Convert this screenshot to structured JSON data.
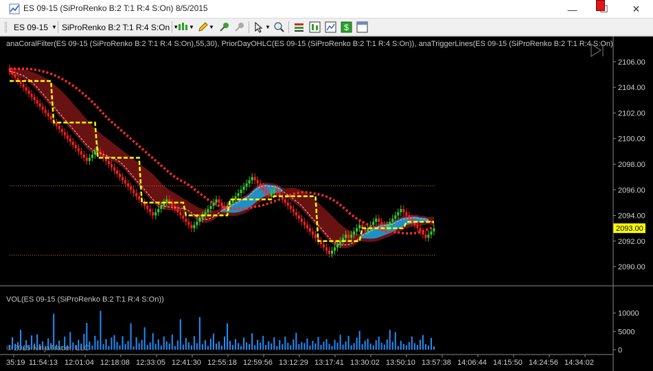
{
  "window": {
    "title": "ES 09-15 (SiProRenko B:2 T:1 R:4 S:On)  8/5/2015",
    "minimize_glyph": "—",
    "maximize_glyph": "☐",
    "close_glyph": "✕"
  },
  "toolbar": {
    "instrument": "ES 09-15",
    "period": "SiProRenko B:2 T:1 R:4 S:On",
    "icons": [
      "bar-type-icon",
      "drawing-pen-icon",
      "pin-icon",
      "pin-gray-icon",
      "pointer-icon",
      "zoom-icon",
      "indicators-icon",
      "strategies-icon",
      "chart-properties-icon",
      "dollar-icon",
      "data-box-icon"
    ]
  },
  "chart": {
    "indicator_label": "anaCoralFilter(ES 09-15 (SiProRenko B:2 T:1 R:4 S:On),55,30), PriorDayOHLC(ES 09-15 (SiProRenko B:2 T:1 R:4 S:On)), anaTriggerLines(ES 09-15 (SiProRenko B:2 T:1 R:4 S:On)",
    "volume_label": "VOL(ES 09-15 (SiProRenko B:2 T:1 R:4 S:On))",
    "copyright": "© 2015 NinjaTrader, LLC",
    "last_price": "2093.00",
    "colors": {
      "up_bar": "#32cd32",
      "down_bar": "#ff2020",
      "coral_band": "#7a1515",
      "coral_band_bull": "#1e90c8",
      "trigger_dot": "#ff2a2a",
      "trigger_dash": "#ffff00",
      "trigger_cyan": "#1ec8e6",
      "prior_day_line": "#c87832",
      "volume": "#1e90ff",
      "last_price_bg": "#ffff00"
    }
  },
  "chart_data": {
    "type": "line",
    "price_panel": {
      "ylim": [
        2089.2,
        2106.8
      ],
      "yticks": [
        "2106.00",
        "2104.00",
        "2102.00",
        "2100.00",
        "2098.00",
        "2096.00",
        "2094.00",
        "2092.00",
        "2090.00"
      ],
      "prior_day_high": 2096.3,
      "prior_day_low": 2090.9,
      "renko_close": [
        2105.25,
        2105.0,
        2104.75,
        2104.5,
        2104.25,
        2104.0,
        2103.75,
        2103.5,
        2103.25,
        2103.0,
        2102.75,
        2102.5,
        2102.25,
        2102.0,
        2101.75,
        2101.5,
        2101.25,
        2101.0,
        2100.75,
        2100.5,
        2100.25,
        2100.0,
        2099.75,
        2099.5,
        2099.25,
        2099.0,
        2098.75,
        2098.5,
        2098.25,
        2098.5,
        2098.75,
        2099.0,
        2099.25,
        2098.75,
        2098.5,
        2098.25,
        2098.0,
        2097.75,
        2097.5,
        2097.25,
        2097.0,
        2096.75,
        2096.5,
        2096.25,
        2096.0,
        2095.75,
        2095.5,
        2095.25,
        2095.0,
        2094.75,
        2094.5,
        2094.25,
        2094.0,
        2094.25,
        2094.5,
        2094.75,
        2095.0,
        2095.25,
        2095.0,
        2094.75,
        2094.5,
        2094.25,
        2094.0,
        2093.75,
        2093.5,
        2093.25,
        2093.0,
        2093.25,
        2093.5,
        2093.75,
        2094.0,
        2094.25,
        2094.5,
        2094.75,
        2095.0,
        2095.25,
        2095.0,
        2094.75,
        2094.5,
        2094.75,
        2095.0,
        2095.25,
        2095.5,
        2095.75,
        2096.0,
        2096.25,
        2096.5,
        2096.75,
        2097.0,
        2096.75,
        2096.5,
        2096.25,
        2096.0,
        2095.75,
        2095.5,
        2095.75,
        2096.0,
        2095.75,
        2095.5,
        2095.25,
        2095.0,
        2094.75,
        2094.5,
        2094.25,
        2094.0,
        2093.75,
        2093.5,
        2093.25,
        2093.0,
        2092.75,
        2092.5,
        2092.25,
        2092.0,
        2091.75,
        2091.5,
        2091.25,
        2091.0,
        2091.25,
        2091.5,
        2091.75,
        2092.0,
        2092.25,
        2092.5,
        2092.25,
        2092.5,
        2092.75,
        2093.0,
        2093.25,
        2093.0,
        2092.75,
        2093.0,
        2093.25,
        2093.5,
        2093.75,
        2093.5,
        2093.25,
        2093.0,
        2093.25,
        2093.5,
        2093.75,
        2094.0,
        2094.25,
        2094.5,
        2094.25,
        2094.0,
        2093.75,
        2093.5,
        2093.25,
        2093.0,
        2092.75,
        2092.5,
        2092.25,
        2092.5,
        2092.75,
        2093.0
      ]
    },
    "volume_panel": {
      "ylim": [
        0,
        12000
      ],
      "yticks": [
        "10000",
        "5000",
        "0"
      ],
      "values": [
        1200,
        3400,
        1600,
        2100,
        5400,
        800,
        2600,
        1100,
        3900,
        1700,
        4200,
        1500,
        2300,
        900,
        3100,
        1800,
        9800,
        1400,
        2500,
        1000,
        3600,
        1200,
        4800,
        2000,
        1300,
        2700,
        1700,
        4300,
        7300,
        2200,
        1100,
        3800,
        2500,
        10600,
        1500,
        2900,
        1000,
        3300,
        4000,
        2100,
        1200,
        3700,
        1600,
        2400,
        7200,
        900,
        3400,
        1800,
        2700,
        6100,
        1300,
        2000,
        4500,
        1600,
        2800,
        1100,
        3600,
        2300,
        1700,
        4100,
        1000,
        2500,
        8300,
        1400,
        3200,
        2000,
        1200,
        3700,
        1800,
        8900,
        1500,
        2600,
        1000,
        3000,
        4400,
        1700,
        2200,
        1100,
        3600,
        7200,
        2400,
        1300,
        2900,
        1800,
        1000,
        3300,
        2000,
        1500,
        4500,
        1200,
        2700,
        1900,
        3800,
        1300,
        2300,
        1700,
        3400,
        1000,
        2600,
        1500,
        3600,
        1900,
        1200,
        2800,
        4600,
        1500,
        2100,
        1800,
        3100,
        1100,
        2400,
        1700,
        3500,
        1300,
        2200,
        2900,
        1600,
        1000,
        2700,
        1900,
        4100,
        1400,
        2300,
        3800,
        1200,
        1800,
        3300,
        5100,
        1500,
        2500,
        3000,
        1700,
        1200,
        2600,
        3600,
        1900,
        1400,
        2800,
        5400,
        2200,
        4800,
        1000,
        2400,
        1600,
        1200,
        2100,
        3600,
        1800,
        1300,
        2700,
        4000,
        1500,
        1100,
        3200,
        900
      ]
    },
    "x_tick_labels": [
      "35:19",
      "11:54:13",
      "12:01:04",
      "12:18:08",
      "12:33:05",
      "12:41:30",
      "12:55:18",
      "12:59:56",
      "13:12:29",
      "13:17:41",
      "13:30:02",
      "13:50:10",
      "13:57:38",
      "14:06:44",
      "14:15:50",
      "14:24:56",
      "14:34:02"
    ]
  }
}
